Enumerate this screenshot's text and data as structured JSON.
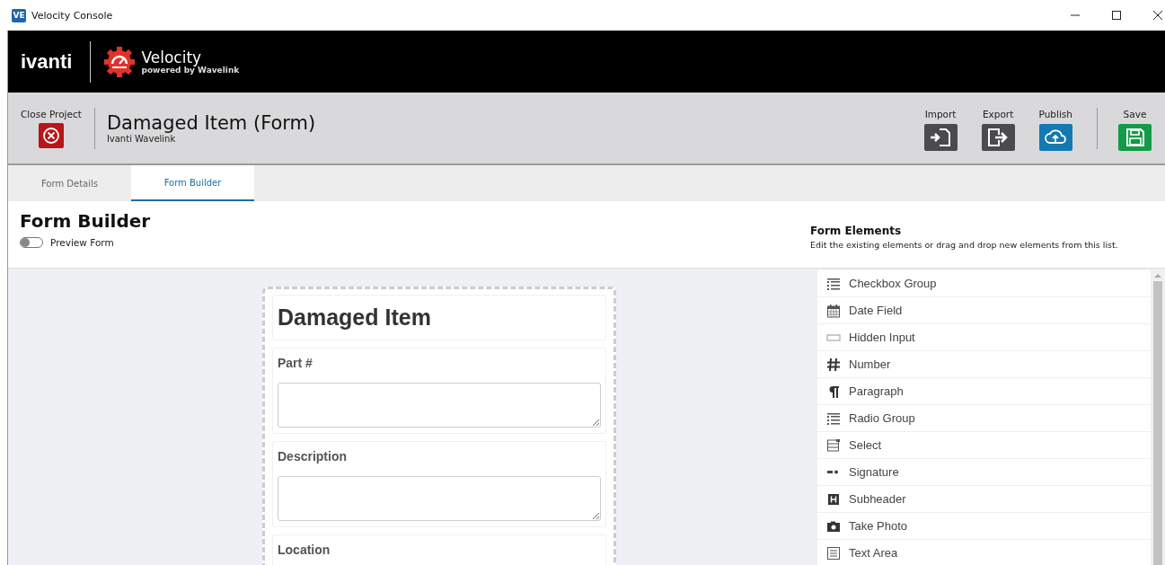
{
  "window": {
    "title": "Velocity Console",
    "app_icon": "VE"
  },
  "header": {
    "brand": "ivanti",
    "product": "Velocity",
    "tagline": "powered by Wavelink"
  },
  "project": {
    "close_label": "Close Project",
    "title": "Damaged Item (Form)",
    "subtitle": "Ivanti Wavelink",
    "actions": [
      {
        "label": "Import",
        "kind": "import"
      },
      {
        "label": "Export",
        "kind": "export"
      },
      {
        "label": "Publish",
        "kind": "publish"
      },
      {
        "label": "Save",
        "kind": "save"
      }
    ]
  },
  "tabs": [
    {
      "label": "Form Details",
      "selected": false
    },
    {
      "label": "Form Builder",
      "selected": true
    }
  ],
  "builder": {
    "title": "Form Builder",
    "preview": {
      "label": "Preview Form",
      "on": false
    }
  },
  "form": {
    "fields": [
      {
        "kind": "heading",
        "label": "Damaged Item"
      },
      {
        "kind": "textarea",
        "label": "Part #"
      },
      {
        "kind": "textarea",
        "label": "Description"
      },
      {
        "kind": "textarea",
        "label": "Location"
      }
    ]
  },
  "elements": {
    "title": "Form Elements",
    "hint": "Edit the existing elements or drag and drop new elements from this list.",
    "items": [
      {
        "label": "Checkbox Group",
        "kind": "checklist"
      },
      {
        "label": "Date Field",
        "kind": "date"
      },
      {
        "label": "Hidden Input",
        "kind": "hidden"
      },
      {
        "label": "Number",
        "kind": "number"
      },
      {
        "label": "Paragraph",
        "kind": "paragraph"
      },
      {
        "label": "Radio Group",
        "kind": "radiolist"
      },
      {
        "label": "Select",
        "kind": "select"
      },
      {
        "label": "Signature",
        "kind": "signature"
      },
      {
        "label": "Subheader",
        "kind": "subheader"
      },
      {
        "label": "Take Photo",
        "kind": "photo"
      },
      {
        "label": "Text Area",
        "kind": "textarea"
      }
    ]
  }
}
